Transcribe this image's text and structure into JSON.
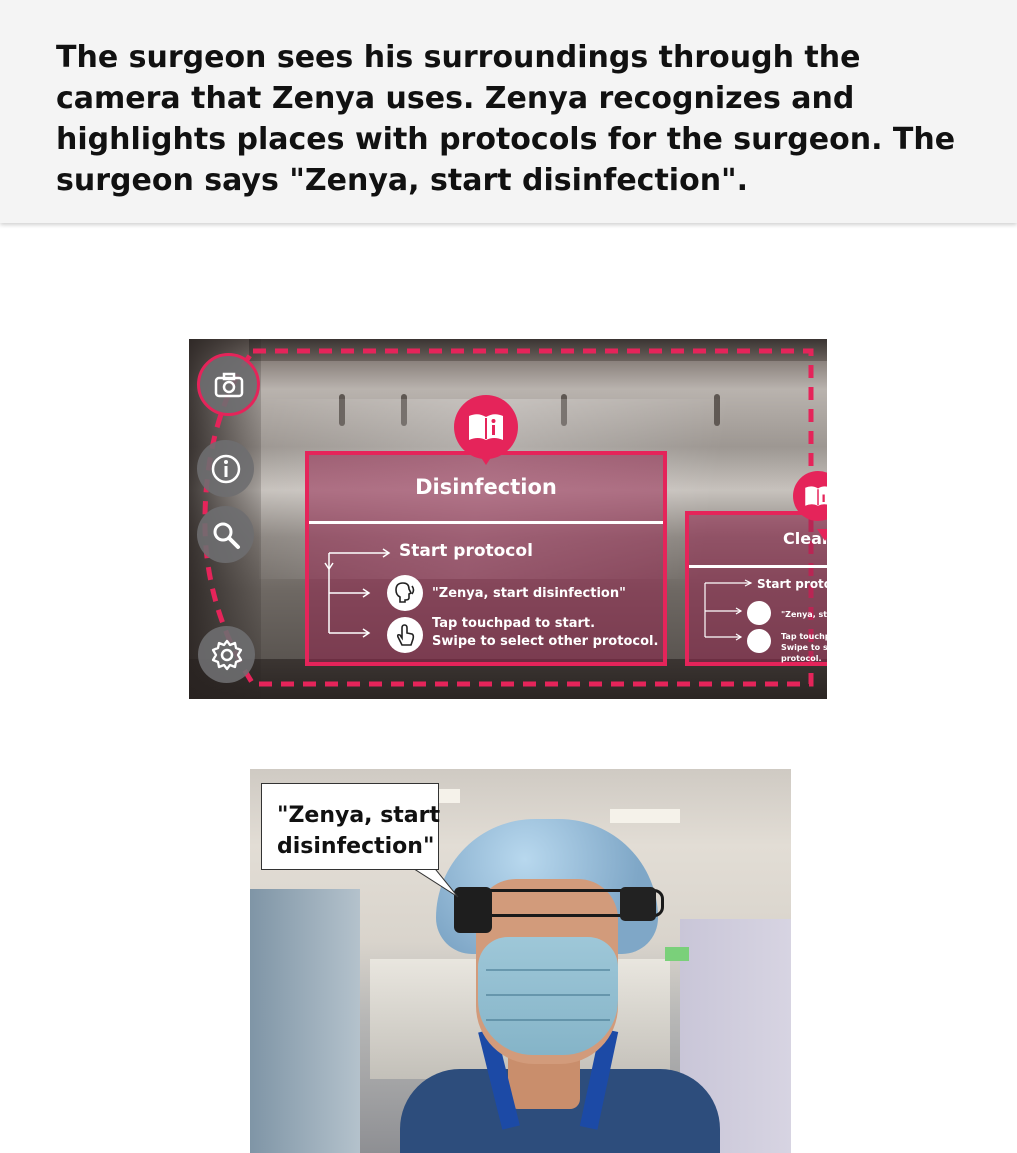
{
  "caption": {
    "text": "The surgeon sees his surroundings through the camera that Zenya uses. Zenya recognizes and highlights places with protocols for the surgeon. The surgeon says \"Zenya, start disinfection\"."
  },
  "ar_view": {
    "side_buttons": [
      {
        "icon": "camera-icon"
      },
      {
        "icon": "info-icon"
      },
      {
        "icon": "search-icon"
      },
      {
        "icon": "gear-icon"
      }
    ],
    "main_card": {
      "pin_icon": "book-info-icon",
      "title": "Disinfection",
      "protocol_label": "Start protocol",
      "option_voice": "\"Zenya, start disinfection\"",
      "option_touch_line1": "Tap touchpad to start.",
      "option_touch_line2": "Swipe to select other protocol."
    },
    "side_card": {
      "pin_icon": "book-info-icon",
      "title": "Clean",
      "protocol_label": "Start protoco",
      "option_voice": "\"Zenya, star",
      "option_touch": "Tap touchpa Swipe to se protocol."
    },
    "colors": {
      "accent": "#e5245a",
      "card_fill": "#96284f"
    }
  },
  "photo": {
    "speech_line1": "\"Zenya, start",
    "speech_line2": "disinfection\""
  }
}
